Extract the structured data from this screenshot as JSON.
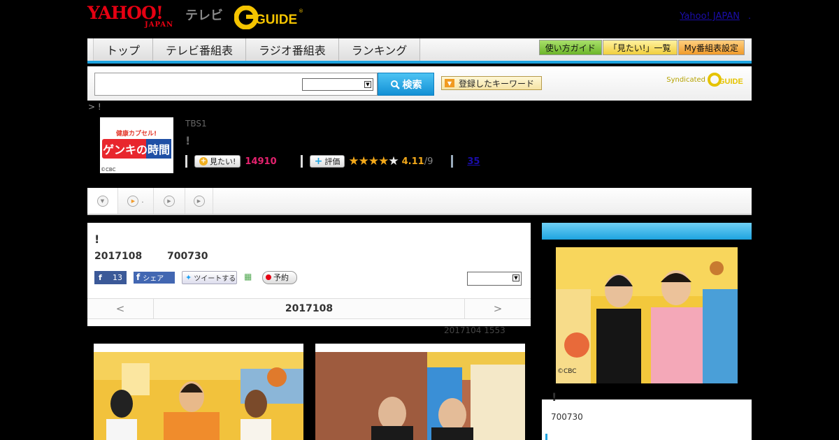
{
  "header": {
    "yahoo_logo": "YAHOO!",
    "japan": "JAPAN",
    "tv": "テレビ",
    "gguide": "GUIDE",
    "yahoo_link": "Yahoo! JAPAN",
    "link_suffix": "."
  },
  "nav": {
    "tabs": [
      "トップ",
      "テレビ番組表",
      "ラジオ番組表",
      "ランキング"
    ],
    "buttons": [
      "使い方ガイド",
      "「見たい!」一覧",
      "My番組表設定"
    ]
  },
  "search": {
    "button_label": "検索",
    "keyword_button": "登録したキーワード",
    "syndicated": "Syndicated",
    "syndicated_logo": "GUIDE"
  },
  "breadcrumb": "> !",
  "program": {
    "channel": "TBS1",
    "title": "!",
    "thumb_line1": "健康カプセル!",
    "thumb_line2": "ゲンキの時間",
    "thumb_credit": "©CBC",
    "mita_label": "見たい!",
    "mita_count": "14910",
    "eval_label": "評価",
    "rating": "4.11",
    "rating_max": "/9",
    "stars_filled": 4,
    "review_count": "35"
  },
  "subtabs": {
    "second_text": "."
  },
  "detail": {
    "title": "!",
    "date": "2017108",
    "time": "700730",
    "fb_count": "13",
    "fb_share": "シェア",
    "tweet": "ツイートする",
    "reserve": "予約",
    "nav_prev": "<",
    "nav_next": ">",
    "nav_date": "2017108",
    "update_note": "2017104  1553"
  },
  "sidebar": {
    "title": "!",
    "time": "700730",
    "photo_credit": "©CBC"
  },
  "colors": {
    "accent_blue": "#1ea4e0",
    "yahoo_red": "#e60012",
    "mita_pink": "#e4226e",
    "star_gold": "#f2a81a"
  }
}
